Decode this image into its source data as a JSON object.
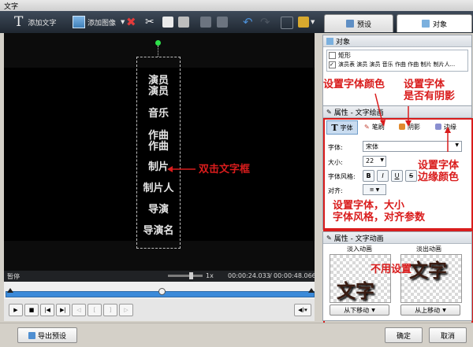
{
  "window": {
    "title": "文字"
  },
  "toolbar": {
    "add_text_label": "添加文字",
    "add_image_label": "添加图像"
  },
  "tabs": [
    {
      "label": "预设"
    },
    {
      "label": "对象"
    }
  ],
  "preview": {
    "credits": [
      "演员\n演员",
      "音乐",
      "作曲\n作曲",
      "制片",
      "制片人",
      "导演",
      "导演名"
    ]
  },
  "annotations": {
    "double_click": "双击文字框",
    "font_color": "设置字体颜色",
    "shadow": "设置字体\n是否有阴影",
    "border_color": "设置字体\n边缘颜色",
    "size_style": "设置字体，大小\n字体风格，对齐参数",
    "unused": "不用设置"
  },
  "status": {
    "label": "暂停",
    "zoom": "1x",
    "current_time": "00:00:24.033",
    "total_time": "00:00:48.066",
    "separator": "/"
  },
  "objects_panel": {
    "title": "对象",
    "items": [
      {
        "label": "矩形",
        "checked": false
      },
      {
        "label": "演员表 演员 演员 音乐 作曲 作曲 制片 制片人...",
        "checked": true
      }
    ]
  },
  "props_panel": {
    "title": "属性 - 文字绘画",
    "subtabs": [
      {
        "label": "字体"
      },
      {
        "label": "笔刷"
      },
      {
        "label": "阴影"
      },
      {
        "label": "边缘"
      }
    ],
    "font_label": "字体:",
    "font_value": "宋体",
    "size_label": "大小:",
    "size_value": "22",
    "style_label": "字体风格:",
    "style_buttons": [
      "B",
      "I",
      "U",
      "S"
    ],
    "align_label": "对齐:"
  },
  "anim_panel": {
    "title": "属性 - 文字动画",
    "in_label": "淡入动画",
    "out_label": "淡出动画",
    "preview_text": "文字",
    "in_select": "从下移动",
    "out_select": "从上移动"
  },
  "buttons": {
    "export": "导出预设",
    "ok": "确定",
    "cancel": "取消"
  },
  "colors": {
    "annotation": "#d91c1c",
    "toolbar": "#2a333e",
    "accent": "#2b73c9"
  }
}
